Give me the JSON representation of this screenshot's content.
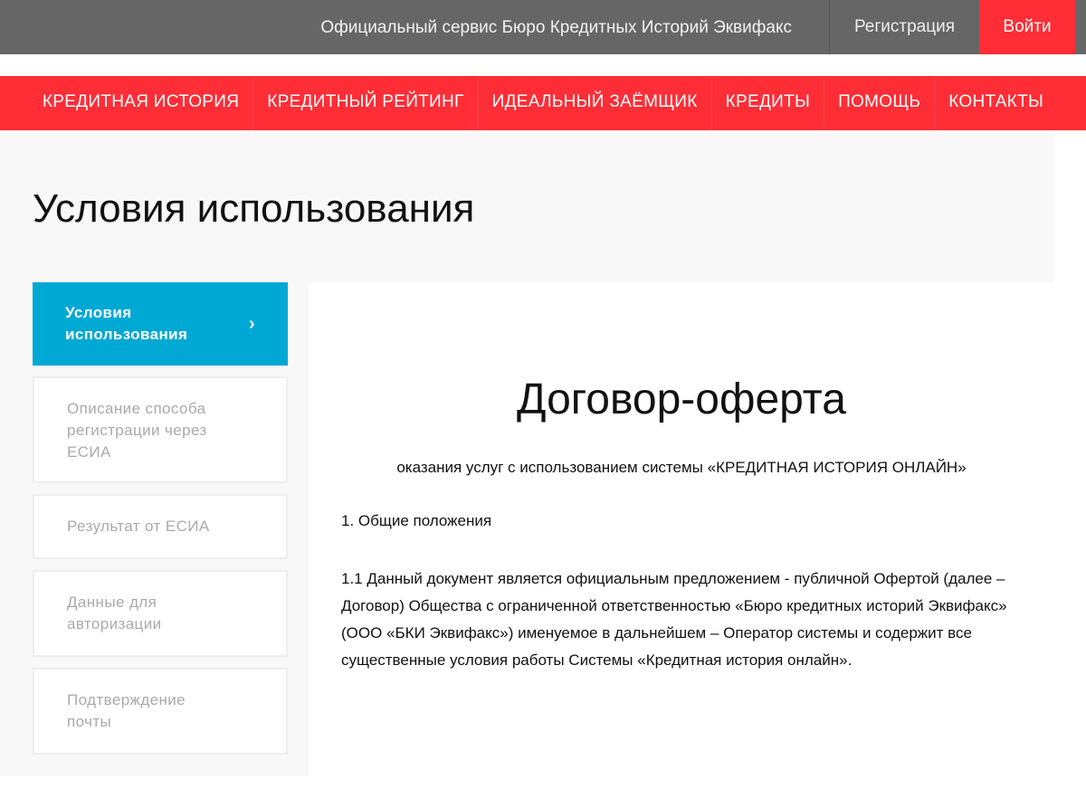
{
  "header": {
    "title": "Официальный сервис Бюро Кредитных Историй Эквифакс",
    "register": "Регистрация",
    "login": "Войти"
  },
  "nav": [
    "КРЕДИТНАЯ ИСТОРИЯ",
    "КРЕДИТНЫЙ РЕЙТИНГ",
    "ИДЕАЛЬНЫЙ ЗАЁМЩИК",
    "КРЕДИТЫ",
    "ПОМОЩЬ",
    "КОНТАКТЫ"
  ],
  "page_title": "Условия использования",
  "sidebar": {
    "items": [
      {
        "label": "Условия использования",
        "chevron": "›"
      },
      {
        "label": "Описание способа регистрации через ЕСИА"
      },
      {
        "label": "Результат от ЕСИА"
      },
      {
        "label": "Данные для авторизации"
      },
      {
        "label": "Подтверждение почты"
      }
    ]
  },
  "document": {
    "title": "Договор-оферта",
    "subtitle": "оказания услуг с использованием системы «КРЕДИТНАЯ ИСТОРИЯ ОНЛАЙН»",
    "section": "1. Общие положения",
    "paragraph": "1.1 Данный документ является официальным предложением - публичной Офертой (далее – Договор) Общества с ограниченной ответственностью «Бюро кредитных историй Эквифакс» (ООО «БКИ Эквифакс») именуемое в дальнейшем – Оператор системы и содержит все существенные условия работы Системы «Кредитная история онлайн»."
  }
}
